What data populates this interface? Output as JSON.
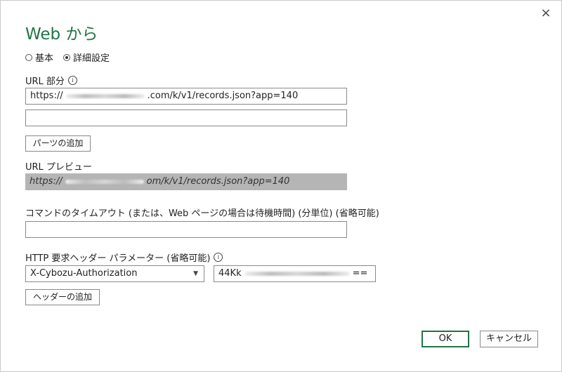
{
  "dialog": {
    "title": "Web から",
    "close_icon": "×"
  },
  "mode": {
    "basic_label": "基本",
    "advanced_label": "詳細設定",
    "selected": "advanced"
  },
  "url_parts": {
    "label": "URL 部分",
    "info_icon": "i",
    "part1_prefix": "https://",
    "part1_suffix": ".com/k/v1/records.json?app=140",
    "part2_value": "",
    "add_part_button": "パーツの追加"
  },
  "url_preview": {
    "label": "URL プレビュー",
    "prefix": "https://",
    "suffix": "om/k/v1/records.json?app=140"
  },
  "timeout": {
    "label": "コマンドのタイムアウト (または、Web ページの場合は待機時間) (分単位) (省略可能)",
    "value": ""
  },
  "headers": {
    "label": "HTTP 要求ヘッダー パラメーター (省略可能)",
    "info_icon": "i",
    "selected_header": "X-Cybozu-Authorization",
    "value_prefix": "44Kk",
    "value_suffix": "==",
    "add_header_button": "ヘッダーの追加"
  },
  "footer": {
    "ok_label": "OK",
    "cancel_label": "キャンセル"
  },
  "colors": {
    "accent": "#217346",
    "preview_bg": "#b5b5b5"
  }
}
